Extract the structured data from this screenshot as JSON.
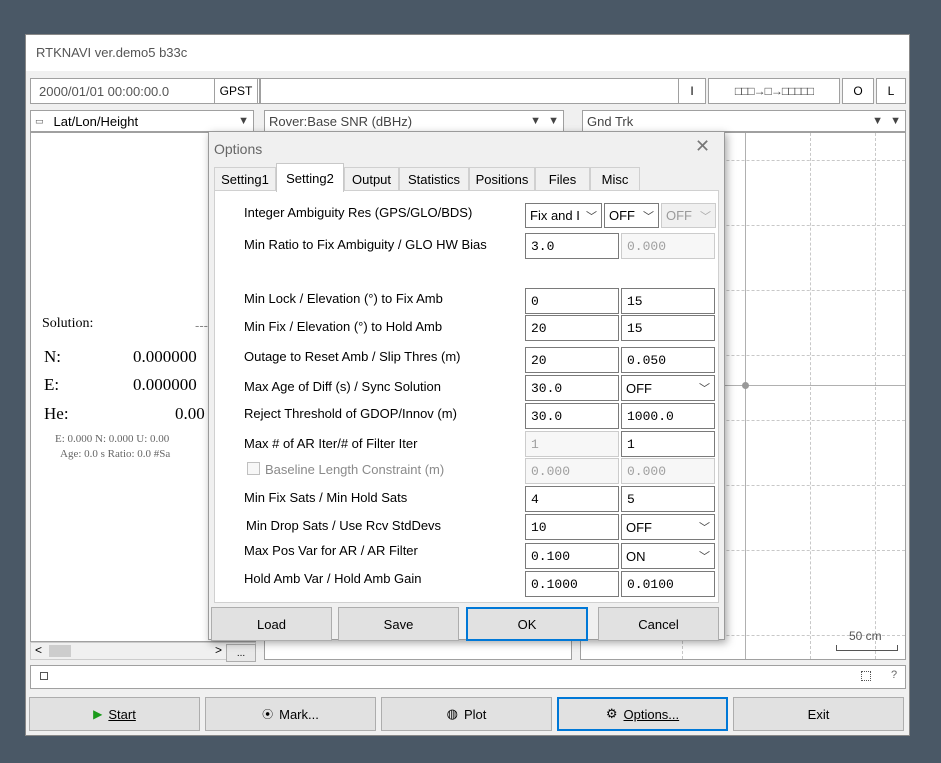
{
  "window": {
    "title": "RTKNAVI ver.demo5 b33c"
  },
  "toolbar": {
    "time": "2000/01/01 00:00:00.0",
    "time_system": "GPST",
    "stream_i": "I",
    "stream_status": "□□□→□→□□□□□",
    "stream_o": "O",
    "stream_l": "L"
  },
  "panels": {
    "left_select": "Lat/Lon/Height",
    "mid_select": "Rover:Base SNR (dBHz)",
    "right_select": "Gnd Trk",
    "solution_label": "Solution:",
    "solution_dash": "---",
    "n_label": "N:",
    "n_value": "0.000000",
    "e_label": "E:",
    "e_value": "0.000000",
    "h_label": "He:",
    "h_value": "0.00",
    "std_line": "E: 0.000 N: 0.000 U: 0.00",
    "age_line": "Age: 0.0 s Ratio: 0.0 #Sa",
    "scale_label": "50 cm",
    "scroll_btn": "..."
  },
  "bottom_buttons": {
    "start": "Start",
    "mark": "Mark...",
    "plot": "Plot",
    "options": "Options...",
    "exit": "Exit"
  },
  "status_bar": {
    "help": "?"
  },
  "dialog": {
    "title": "Options",
    "tabs": [
      "Setting1",
      "Setting2",
      "Output",
      "Statistics",
      "Positions",
      "Files",
      "Misc"
    ],
    "rows": {
      "ar_label": "Integer Ambiguity Res (GPS/GLO/BDS)",
      "ar_gps": "Fix and I",
      "ar_glo": "OFF",
      "ar_bds": "OFF",
      "ratio_label": "Min Ratio to Fix Ambiguity / GLO HW Bias",
      "ratio_value": "3.0",
      "glo_hw_bias": "0.000",
      "lock_label": "Min Lock / Elevation (°) to Fix Amb",
      "lock_value": "0",
      "lock_elev": "15",
      "fix_label": "Min Fix / Elevation (°) to Hold Amb",
      "fix_value": "20",
      "fix_elev": "15",
      "outage_label": "Outage to Reset Amb / Slip Thres (m)",
      "outage_value": "20",
      "slip_thres": "0.050",
      "age_label": "Max Age of Diff (s) / Sync Solution",
      "age_value": "30.0",
      "sync_solution": "OFF",
      "reject_label": "Reject Threshold of GDOP/Innov (m)",
      "gdop_value": "30.0",
      "innov_value": "1000.0",
      "iter_label": "Max # of AR Iter/# of Filter Iter",
      "ar_iter": "1",
      "filter_iter": "1",
      "baseline_label": "Baseline Length Constraint (m)",
      "baseline_len": "0.000",
      "baseline_sig": "0.000",
      "minsats_label": "Min Fix Sats / Min Hold Sats",
      "min_fix_sats": "4",
      "min_hold_sats": "5",
      "drop_label": "Min Drop Sats  / Use Rcv StdDevs",
      "min_drop_sats": "10",
      "rcv_stddevs": "OFF",
      "posvar_label": "Max Pos Var for AR  / AR Filter",
      "pos_var": "0.100",
      "ar_filter": "ON",
      "hold_label": "Hold Amb Var / Hold Amb Gain",
      "hold_var": "0.1000",
      "hold_gain": "0.0100"
    },
    "buttons": {
      "load": "Load",
      "save": "Save",
      "ok": "OK",
      "cancel": "Cancel"
    }
  }
}
